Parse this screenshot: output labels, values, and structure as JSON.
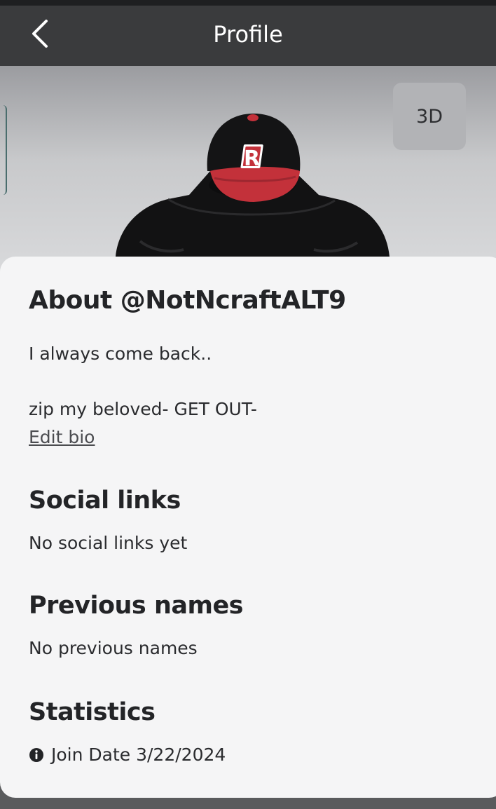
{
  "header": {
    "title": "Profile",
    "back_icon": "chevron-left-icon"
  },
  "avatar_stage": {
    "view_toggle_label": "3D",
    "cap_letter": "R"
  },
  "about": {
    "title": "About @NotNcraftALT9",
    "bio_lines": [
      "I always come back..",
      "zip my beloved- GET OUT-"
    ],
    "edit_bio_label": "Edit bio"
  },
  "social_links": {
    "title": "Social links",
    "empty_text": "No social links yet"
  },
  "previous_names": {
    "title": "Previous names",
    "empty_text": "No previous names"
  },
  "statistics": {
    "title": "Statistics",
    "join_date_label": "Join Date 3/22/2024",
    "info_icon": "info-icon"
  },
  "colors": {
    "header_bg": "#3a3b3d",
    "card_bg": "#f5f5f6",
    "cap_red": "#c3313a"
  }
}
